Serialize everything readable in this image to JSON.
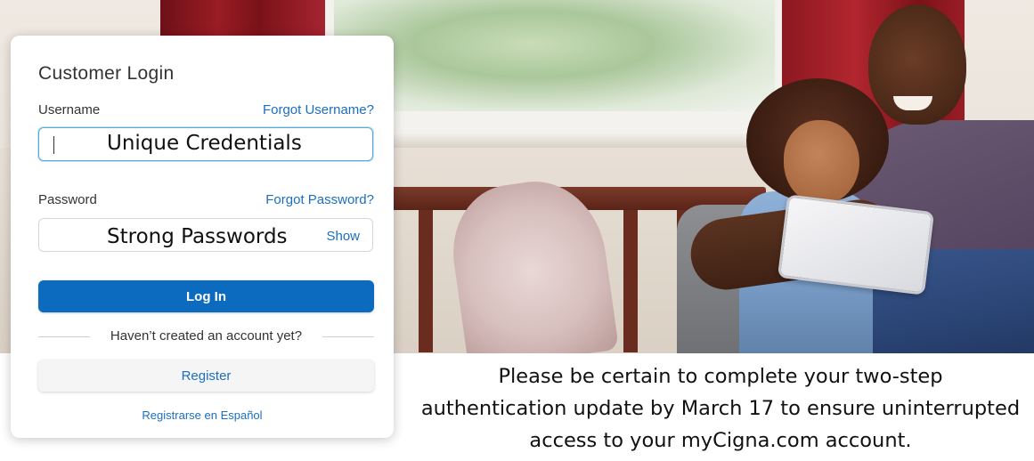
{
  "login": {
    "title": "Customer Login",
    "username_label": "Username",
    "forgot_username": "Forgot Username?",
    "username_value": "Unique Credentials",
    "password_label": "Password",
    "forgot_password": "Forgot Password?",
    "password_value": "Strong Passwords",
    "show_label": "Show",
    "login_button": "Log In",
    "divider_text": "Haven’t created an account yet?",
    "register_button": "Register",
    "spanish_link": "Registrarse en Español"
  },
  "notice": {
    "lines": [
      "Please be certain to complete your two-step",
      "authentication update by March 17 to ensure uninterrupted",
      "access to your myCigna.com account."
    ]
  },
  "colors": {
    "primary_blue": "#0d6bbf",
    "link_blue": "#1a6fc1",
    "focus_border": "#5aa9d8"
  }
}
